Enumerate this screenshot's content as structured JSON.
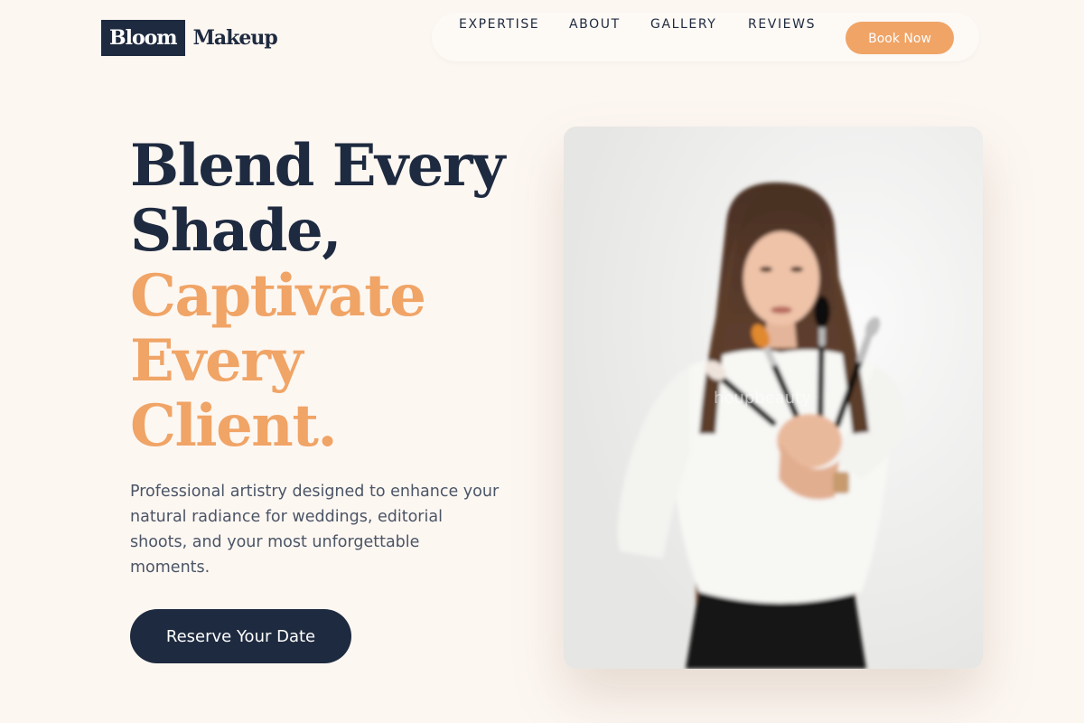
{
  "brand": {
    "logo_box": "Bloom",
    "logo_text": "Makeup"
  },
  "nav": {
    "items": [
      "EXPERTISE",
      "ABOUT",
      "GALLERY",
      "REVIEWS"
    ],
    "book_label": "Book Now"
  },
  "hero": {
    "headline_dark": [
      "Blend Every",
      "Shade,"
    ],
    "headline_accent": [
      "Captivate",
      "Every",
      "Client."
    ],
    "description": "Professional artistry designed to enhance your natural radiance for weddings, editorial shoots, and your most unforgettable moments.",
    "cta_label": "Reserve Your Date",
    "image_watermark": "houpbeauty"
  },
  "colors": {
    "navy": "#1e2a3f",
    "accent": "#f0a466",
    "background": "#fdf7f2"
  }
}
